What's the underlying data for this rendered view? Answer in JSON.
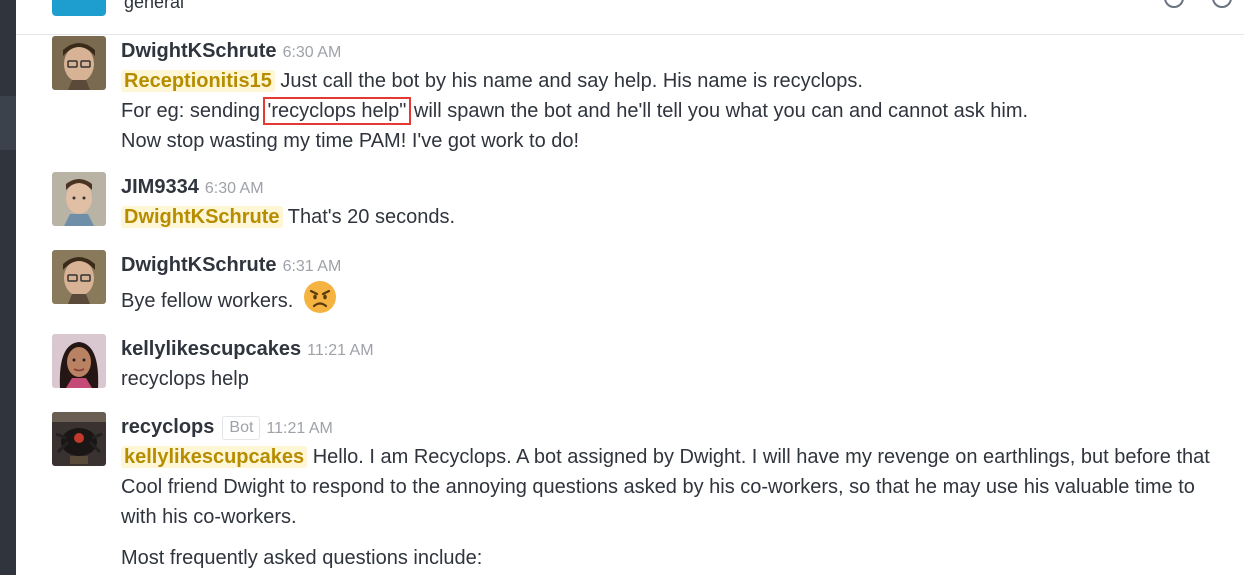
{
  "header": {
    "channel_name": "general"
  },
  "colors": {
    "mention_bg": "#fff6d6",
    "mention_text": "#b68d00",
    "highlight_box": "#e53935",
    "sidebar": "#2f343d"
  },
  "messages": [
    {
      "author": "DwightKSchrute",
      "time": "6:30 AM",
      "mention": "Receptionitis15",
      "line1": "Just call the bot by his name and say help. His name is recyclops.",
      "line2_pre": "For eg: sending",
      "line2_box": "'recyclops help\"",
      "line2_post": "will spawn the bot and he'll tell you what you can and cannot ask him.",
      "line3": "Now stop wasting my time PAM! I've got work to do!"
    },
    {
      "author": "JIM9334",
      "time": "6:30 AM",
      "mention": "DwightKSchrute",
      "line1": "That's 20 seconds."
    },
    {
      "author": "DwightKSchrute",
      "time": "6:31 AM",
      "line1": "Bye fellow workers.",
      "emoji": "angry-face-emoji"
    },
    {
      "author": "kellylikescupcakes",
      "time": "11:21 AM",
      "line1": "recyclops help"
    },
    {
      "author": "recyclops",
      "badge": "Bot",
      "time": "11:21 AM",
      "mention": "kellylikescupcakes",
      "line1": "Hello. I am Recyclops. A bot assigned by Dwight. I will have my revenge on earthlings, but before that",
      "line2": "Cool friend Dwight to respond to the annoying questions asked by his co-workers, so that he may use his valuable time to",
      "line3": "with his co-workers.",
      "line4": "Most frequently asked questions include:"
    }
  ]
}
